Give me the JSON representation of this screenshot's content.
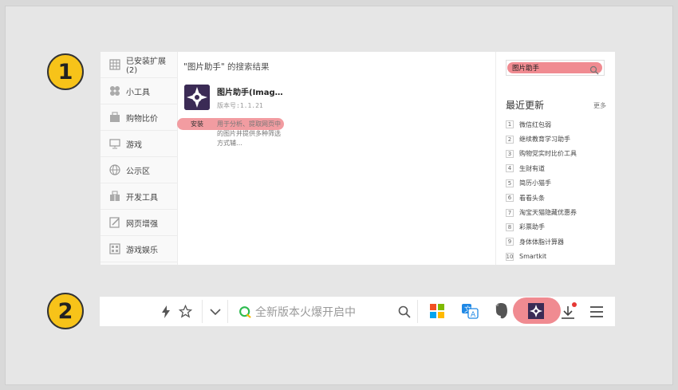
{
  "steps": [
    "1",
    "2"
  ],
  "panel1": {
    "sidebar": [
      {
        "label": "已安装扩展(2)",
        "icon": "grid-icon"
      },
      {
        "label": "小工具",
        "icon": "clover-icon"
      },
      {
        "label": "购物比价",
        "icon": "bag-icon"
      },
      {
        "label": "游戏",
        "icon": "monitor-icon"
      },
      {
        "label": "公示区",
        "icon": "globe-icon"
      },
      {
        "label": "开发工具",
        "icon": "gift-icon"
      },
      {
        "label": "网页增强",
        "icon": "edit-icon"
      },
      {
        "label": "游戏娱乐",
        "icon": "grid-icon"
      }
    ],
    "search_title_query": "\"图片助手\"",
    "search_title_suffix": " 的搜索结果",
    "result": {
      "name": "图片助手(Imag…",
      "version": "版本号:1.1.21",
      "install_label": "安装",
      "description": "用于分析、提取网页中的图片并提供多种筛选方式辅…"
    },
    "right": {
      "search_value": "图片助手",
      "recent_title": "最近更新",
      "more_label": "更多",
      "recent": [
        {
          "num": "1",
          "label": "微信红包弱"
        },
        {
          "num": "2",
          "label": "继续教育学习助手"
        },
        {
          "num": "3",
          "label": "购物党实时比价工具"
        },
        {
          "num": "4",
          "label": "生财有道"
        },
        {
          "num": "5",
          "label": "简历小猫手"
        },
        {
          "num": "6",
          "label": "看看头条"
        },
        {
          "num": "7",
          "label": "淘宝天猫隐藏优惠券"
        },
        {
          "num": "8",
          "label": "彩票助手"
        },
        {
          "num": "9",
          "label": "身体体脂计算器"
        },
        {
          "num": "10",
          "label": "Smartkit"
        }
      ]
    }
  },
  "panel2": {
    "address_placeholder": "全新版本火爆开启中",
    "icons": [
      "lightning-icon",
      "star-icon",
      "chevron-down-icon",
      "search-engine-icon",
      "search-icon",
      "apps-icon",
      "translate-icon",
      "evernote-icon",
      "image-assistant-icon",
      "download-icon",
      "menu-icon"
    ]
  },
  "colors": {
    "badge": "#f7c319",
    "highlight": "#f08b91",
    "ext_icon_bg": "#3b2b55"
  }
}
